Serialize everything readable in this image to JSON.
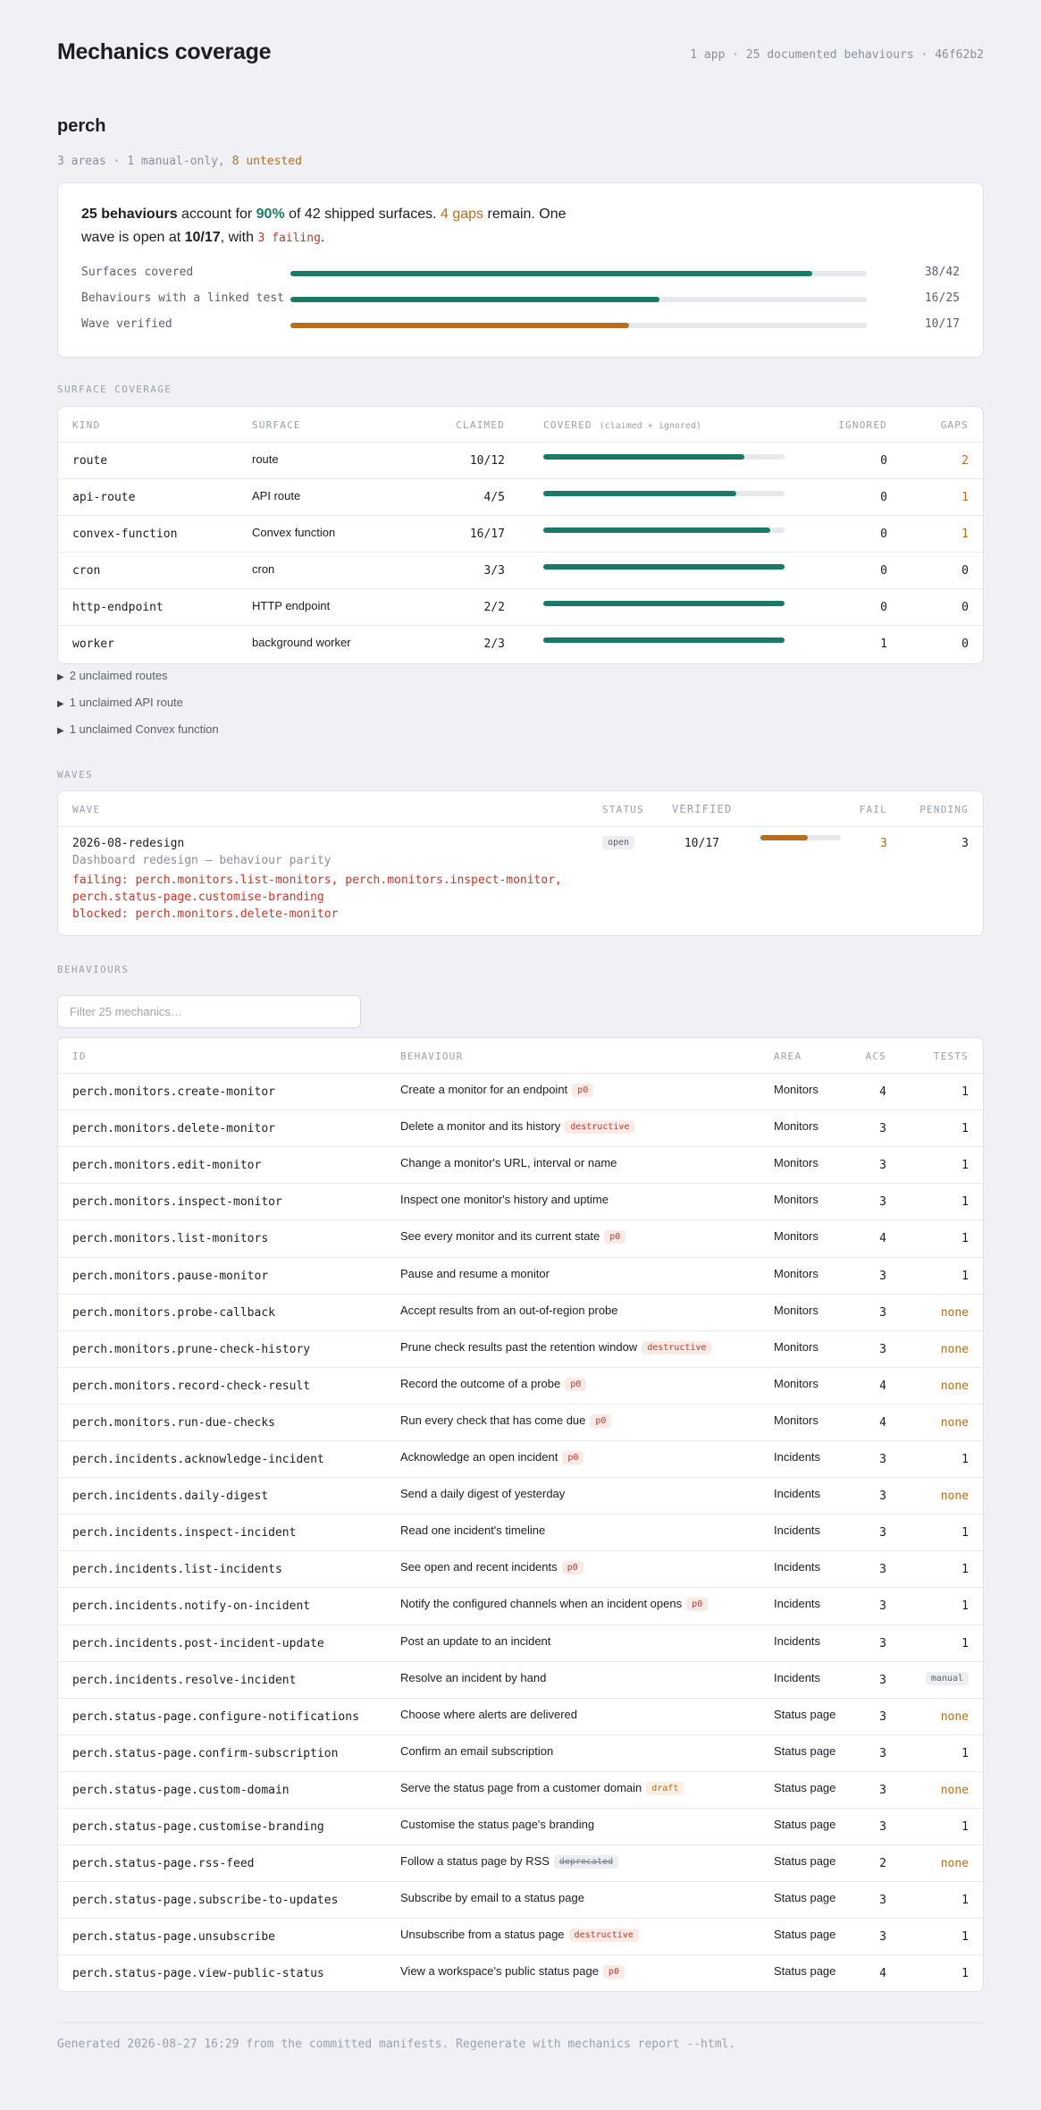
{
  "header": {
    "title": "Mechanics coverage",
    "meta": "1 app · 25 documented behaviours · 46f62b2"
  },
  "app": {
    "name": "perch",
    "sub_prefix": "3 areas · 1 manual-only, ",
    "sub_untested": "8 untested"
  },
  "summary": {
    "behaviours": "25 behaviours",
    "t1": " account for ",
    "pct": "90%",
    "t2": " of 42 shipped surfaces. ",
    "gaps": "4 gaps",
    "t3": " remain. One wave is open at ",
    "wave": "10/17",
    "t4": ", with ",
    "failing": "3 failing",
    "t5": ".",
    "bars": [
      {
        "label": "Surfaces covered",
        "value": "38/42",
        "fraction": 0.905,
        "color": "#1b7a66"
      },
      {
        "label": "Behaviours with a linked test",
        "value": "16/25",
        "fraction": 0.64,
        "color": "#1b7a66"
      },
      {
        "label": "Wave verified",
        "value": "10/17",
        "fraction": 0.588,
        "color": "#b86e1c"
      }
    ]
  },
  "surface": {
    "section": "SURFACE COVERAGE",
    "headers": {
      "kind": "KIND",
      "surface": "SURFACE",
      "claimed": "CLAIMED",
      "covered": "COVERED",
      "covered_note": "(claimed + ignored)",
      "ignored": "IGNORED",
      "gaps": "GAPS"
    },
    "rows": [
      {
        "kind": "route",
        "surface": "route",
        "claimed": "10/12",
        "fraction": 0.833,
        "ignored": "0",
        "gaps": "2"
      },
      {
        "kind": "api-route",
        "surface": "API route",
        "claimed": "4/5",
        "fraction": 0.8,
        "ignored": "0",
        "gaps": "1"
      },
      {
        "kind": "convex-function",
        "surface": "Convex function",
        "claimed": "16/17",
        "fraction": 0.941,
        "ignored": "0",
        "gaps": "1"
      },
      {
        "kind": "cron",
        "surface": "cron",
        "claimed": "3/3",
        "fraction": 1.0,
        "ignored": "0",
        "gaps": "0"
      },
      {
        "kind": "http-endpoint",
        "surface": "HTTP endpoint",
        "claimed": "2/2",
        "fraction": 1.0,
        "ignored": "0",
        "gaps": "0"
      },
      {
        "kind": "worker",
        "surface": "background worker",
        "claimed": "2/3",
        "fraction": 1.0,
        "ignored": "1",
        "gaps": "0"
      }
    ],
    "disclosures": [
      "2 unclaimed routes",
      "1 unclaimed API route",
      "1 unclaimed Convex function"
    ]
  },
  "waves": {
    "section": "WAVES",
    "headers": {
      "wave": "WAVE",
      "status": "STATUS",
      "verified": "VERIFIED",
      "fail": "FAIL",
      "pending": "PENDING"
    },
    "rows": [
      {
        "id": "2026-08-redesign",
        "desc": "Dashboard redesign — behaviour parity",
        "failing_line1": "failing: perch.monitors.list-monitors, perch.monitors.inspect-monitor,",
        "failing_line2": "perch.status-page.customise-branding",
        "blocked": "blocked: perch.monitors.delete-monitor",
        "status": "open",
        "verified": "10/17",
        "fraction": 0.588,
        "fail": "3",
        "pending": "3"
      }
    ]
  },
  "behaviours": {
    "section": "BEHAVIOURS",
    "filter_placeholder": "Filter 25 mechanics…",
    "headers": {
      "id": "ID",
      "behaviour": "BEHAVIOUR",
      "area": "AREA",
      "acs": "ACS",
      "tests": "TESTS"
    },
    "rows": [
      {
        "id": "perch.monitors.create-monitor",
        "text": "Create a monitor for an endpoint",
        "badge": "p0",
        "area": "Monitors",
        "acs": "4",
        "tests": "1"
      },
      {
        "id": "perch.monitors.delete-monitor",
        "text": "Delete a monitor and its history",
        "badge": "destructive",
        "area": "Monitors",
        "acs": "3",
        "tests": "1"
      },
      {
        "id": "perch.monitors.edit-monitor",
        "text": "Change a monitor's URL, interval or name",
        "badge": "",
        "area": "Monitors",
        "acs": "3",
        "tests": "1"
      },
      {
        "id": "perch.monitors.inspect-monitor",
        "text": "Inspect one monitor's history and uptime",
        "badge": "",
        "area": "Monitors",
        "acs": "3",
        "tests": "1"
      },
      {
        "id": "perch.monitors.list-monitors",
        "text": "See every monitor and its current state",
        "badge": "p0",
        "area": "Monitors",
        "acs": "4",
        "tests": "1"
      },
      {
        "id": "perch.monitors.pause-monitor",
        "text": "Pause and resume a monitor",
        "badge": "",
        "area": "Monitors",
        "acs": "3",
        "tests": "1"
      },
      {
        "id": "perch.monitors.probe-callback",
        "text": "Accept results from an out-of-region probe",
        "badge": "",
        "area": "Monitors",
        "acs": "3",
        "tests": "none"
      },
      {
        "id": "perch.monitors.prune-check-history",
        "text": "Prune check results past the retention window",
        "badge": "destructive",
        "area": "Monitors",
        "acs": "3",
        "tests": "none"
      },
      {
        "id": "perch.monitors.record-check-result",
        "text": "Record the outcome of a probe",
        "badge": "p0",
        "area": "Monitors",
        "acs": "4",
        "tests": "none"
      },
      {
        "id": "perch.monitors.run-due-checks",
        "text": "Run every check that has come due",
        "badge": "p0",
        "area": "Monitors",
        "acs": "4",
        "tests": "none"
      },
      {
        "id": "perch.incidents.acknowledge-incident",
        "text": "Acknowledge an open incident",
        "badge": "p0",
        "area": "Incidents",
        "acs": "3",
        "tests": "1"
      },
      {
        "id": "perch.incidents.daily-digest",
        "text": "Send a daily digest of yesterday",
        "badge": "",
        "area": "Incidents",
        "acs": "3",
        "tests": "none"
      },
      {
        "id": "perch.incidents.inspect-incident",
        "text": "Read one incident's timeline",
        "badge": "",
        "area": "Incidents",
        "acs": "3",
        "tests": "1"
      },
      {
        "id": "perch.incidents.list-incidents",
        "text": "See open and recent incidents",
        "badge": "p0",
        "area": "Incidents",
        "acs": "3",
        "tests": "1"
      },
      {
        "id": "perch.incidents.notify-on-incident",
        "text": "Notify the configured channels when an incident opens",
        "badge": "p0",
        "area": "Incidents",
        "acs": "3",
        "tests": "1"
      },
      {
        "id": "perch.incidents.post-incident-update",
        "text": "Post an update to an incident",
        "badge": "",
        "area": "Incidents",
        "acs": "3",
        "tests": "1"
      },
      {
        "id": "perch.incidents.resolve-incident",
        "text": "Resolve an incident by hand",
        "badge": "",
        "area": "Incidents",
        "acs": "3",
        "tests": "manual"
      },
      {
        "id": "perch.status-page.configure-notifications",
        "text": "Choose where alerts are delivered",
        "badge": "",
        "area": "Status page",
        "acs": "3",
        "tests": "none"
      },
      {
        "id": "perch.status-page.confirm-subscription",
        "text": "Confirm an email subscription",
        "badge": "",
        "area": "Status page",
        "acs": "3",
        "tests": "1"
      },
      {
        "id": "perch.status-page.custom-domain",
        "text": "Serve the status page from a customer domain",
        "badge": "draft",
        "area": "Status page",
        "acs": "3",
        "tests": "none"
      },
      {
        "id": "perch.status-page.customise-branding",
        "text": "Customise the status page's branding",
        "badge": "",
        "area": "Status page",
        "acs": "3",
        "tests": "1"
      },
      {
        "id": "perch.status-page.rss-feed",
        "text": "Follow a status page by RSS",
        "badge": "deprecated",
        "area": "Status page",
        "acs": "2",
        "tests": "none"
      },
      {
        "id": "perch.status-page.subscribe-to-updates",
        "text": "Subscribe by email to a status page",
        "badge": "",
        "area": "Status page",
        "acs": "3",
        "tests": "1"
      },
      {
        "id": "perch.status-page.unsubscribe",
        "text": "Unsubscribe from a status page",
        "badge": "destructive",
        "area": "Status page",
        "acs": "3",
        "tests": "1"
      },
      {
        "id": "perch.status-page.view-public-status",
        "text": "View a workspace's public status page",
        "badge": "p0",
        "area": "Status page",
        "acs": "4",
        "tests": "1"
      }
    ]
  },
  "footer": "Generated 2026-08-27 16:29 from the committed manifests. Regenerate with mechanics report --html."
}
